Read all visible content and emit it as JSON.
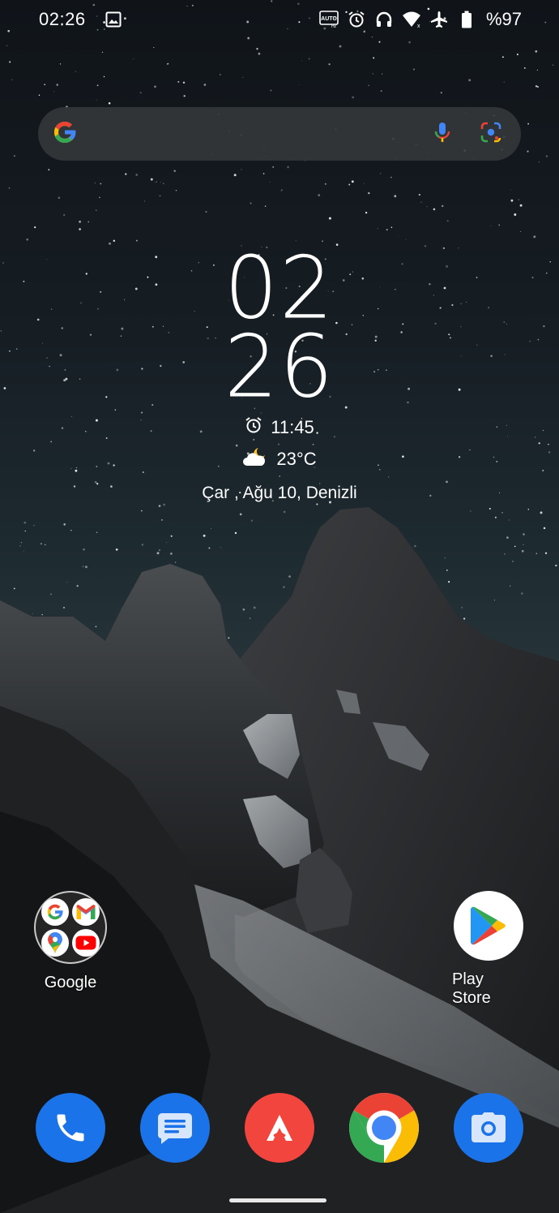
{
  "status_bar": {
    "time": "02:26",
    "battery": "%97",
    "left_icons": [
      "gallery-icon"
    ],
    "right_icons": [
      "auto-hz-icon",
      "alarm-icon",
      "headphones-icon",
      "wifi-icon",
      "airplane-icon",
      "battery-icon"
    ],
    "auto_label": "AUTO"
  },
  "search": {
    "icons": [
      "google-g-icon",
      "mic-icon",
      "lens-icon"
    ]
  },
  "clock": {
    "hours": "02",
    "minutes": "26",
    "alarm": "11:45",
    "temperature": "23°C",
    "date_location": "Çar , Ağu 10, Denizli"
  },
  "apps": {
    "folder": {
      "label": "Google",
      "items": [
        "google-icon",
        "gmail-icon",
        "maps-icon",
        "youtube-icon"
      ]
    },
    "play_store": {
      "label": "Play Store"
    }
  },
  "dock": {
    "items": [
      "phone-icon",
      "messages-icon",
      "arc-icon",
      "chrome-icon",
      "camera-icon"
    ]
  },
  "colors": {
    "google_blue": "#4285F4",
    "google_red": "#EA4335",
    "google_yellow": "#FBBC05",
    "google_green": "#34A853",
    "dock_blue": "#1A73E8",
    "arc_red": "#F2453D"
  }
}
